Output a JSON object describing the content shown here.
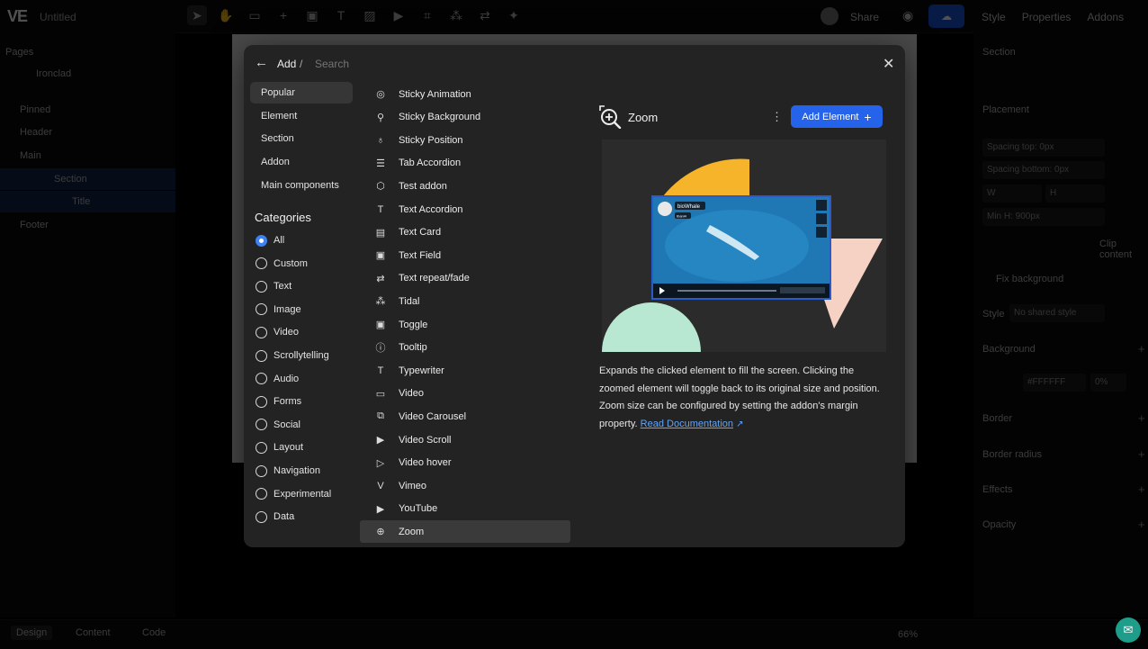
{
  "editor": {
    "doc_title": "Untitled",
    "share_label": "Share",
    "right_tabs": [
      "Style",
      "Properties",
      "Addons"
    ],
    "left_panel": {
      "pages_label": "Pages",
      "page_item": "Ironclad",
      "rows": [
        "Pinned",
        "Header",
        "Main",
        "Section",
        "Title",
        "Footer"
      ]
    },
    "right_panel": {
      "section_label": "Section",
      "placement_label": "Placement",
      "spacing_top": "Spacing top: 0px",
      "spacing_bottom": "Spacing bottom: 0px",
      "w_label": "W",
      "h_label": "H",
      "min_h": "Min H: 900px",
      "clip_content": "Clip content",
      "fix_background": "Fix background",
      "style_label": "Style",
      "style_value": "No shared style",
      "background_label": "Background",
      "bg_hex": "#FFFFFF",
      "bg_opacity": "0%",
      "border_label": "Border",
      "border_radius_label": "Border radius",
      "effects_label": "Effects",
      "opacity_label": "Opacity"
    },
    "bottom_tabs": [
      "Design",
      "Content",
      "Code"
    ],
    "zoom_level": "66%"
  },
  "modal": {
    "breadcrumb_add": "Add",
    "breadcrumb_sep": "/",
    "search_placeholder": "Search",
    "nav": [
      "Popular",
      "Element",
      "Section",
      "Addon",
      "Main components"
    ],
    "categories_heading": "Categories",
    "categories": [
      "All",
      "Custom",
      "Text",
      "Image",
      "Video",
      "Scrollytelling",
      "Audio",
      "Forms",
      "Social",
      "Layout",
      "Navigation",
      "Experimental",
      "Data"
    ],
    "selected_category": "All",
    "addons": [
      {
        "label": "Sticky Animation",
        "icon": "sticky-animation-icon",
        "glyph": "◎"
      },
      {
        "label": "Sticky Background",
        "icon": "pin-icon",
        "glyph": "⚲"
      },
      {
        "label": "Sticky Position",
        "icon": "location-pin-icon",
        "glyph": "♁"
      },
      {
        "label": "Tab Accordion",
        "icon": "list-icon",
        "glyph": "☰"
      },
      {
        "label": "Test addon",
        "icon": "cube-icon",
        "glyph": "⬡"
      },
      {
        "label": "Text Accordion",
        "icon": "text-icon",
        "glyph": "T"
      },
      {
        "label": "Text Card",
        "icon": "card-icon",
        "glyph": "▤"
      },
      {
        "label": "Text Field",
        "icon": "field-icon",
        "glyph": "▣"
      },
      {
        "label": "Text repeat/fade",
        "icon": "repeat-icon",
        "glyph": "⇄"
      },
      {
        "label": "Tidal",
        "icon": "tidal-icon",
        "glyph": "⁂"
      },
      {
        "label": "Toggle",
        "icon": "toggle-icon",
        "glyph": "▣"
      },
      {
        "label": "Tooltip",
        "icon": "info-icon",
        "glyph": "ⓘ"
      },
      {
        "label": "Typewriter",
        "icon": "typewriter-icon",
        "glyph": "T"
      },
      {
        "label": "Video",
        "icon": "video-icon",
        "glyph": "▭"
      },
      {
        "label": "Video Carousel",
        "icon": "carousel-icon",
        "glyph": "⧉"
      },
      {
        "label": "Video Scroll",
        "icon": "play-circle-icon",
        "glyph": "▶"
      },
      {
        "label": "Video hover",
        "icon": "play-outline-icon",
        "glyph": "▷"
      },
      {
        "label": "Vimeo",
        "icon": "vimeo-icon",
        "glyph": "V"
      },
      {
        "label": "YouTube",
        "icon": "youtube-icon",
        "glyph": "▶"
      },
      {
        "label": "Zoom",
        "icon": "zoom-icon",
        "glyph": "⊕"
      }
    ],
    "selected_addon": "Zoom",
    "detail": {
      "title": "Zoom",
      "add_button": "Add Element",
      "add_button_icon": "+",
      "preview_channel": "bioWhale",
      "preview_badge": "Ibani4",
      "description": "Expands the clicked element to fill the screen. Clicking the zoomed element will toggle back to its original size and position. Zoom size can be configured by setting the addon's margin property. ",
      "link_text": "Read Documentation",
      "link_icon": "↗"
    }
  },
  "colors": {
    "accent": "#2563eb",
    "preview_yellow": "#f5b42a",
    "preview_pink": "#f6d2c4",
    "preview_mint": "#b8e8d2",
    "video_blue": "#1f78b4"
  }
}
